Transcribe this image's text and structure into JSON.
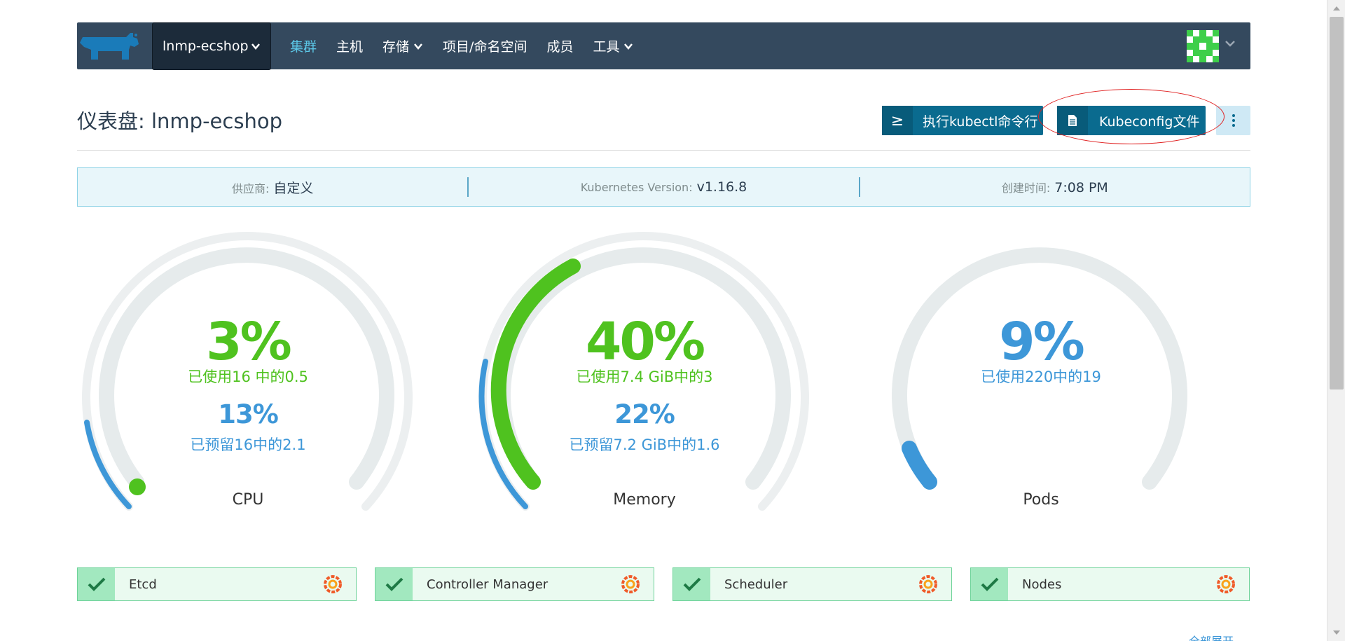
{
  "nav": {
    "cluster": "lnmp-ecshop",
    "items": [
      {
        "label": "集群",
        "active": true,
        "dropdown": false
      },
      {
        "label": "主机",
        "active": false,
        "dropdown": false
      },
      {
        "label": "存储",
        "active": false,
        "dropdown": true
      },
      {
        "label": "项目/命名空间",
        "active": false,
        "dropdown": false
      },
      {
        "label": "成员",
        "active": false,
        "dropdown": false
      },
      {
        "label": "工具",
        "active": false,
        "dropdown": true
      }
    ]
  },
  "header": {
    "title": "仪表盘: lnmp-ecshop",
    "kubectl_icon": "≥",
    "kubectl_label": "执行kubectl命令行",
    "kubeconfig_label": "Kubeconfig文件"
  },
  "info": {
    "provider_key": "供应商:",
    "provider_val": "自定义",
    "version_key": "Kubernetes Version:",
    "version_val": "v1.16.8",
    "created_key": "创建时间:",
    "created_val": "7:08 PM"
  },
  "gauges": {
    "cpu": {
      "used_pct": "3%",
      "used_text": "已使用16 中的0.5",
      "reserved_pct": "13%",
      "reserved_text": "已预留16中的2.1",
      "label": "CPU"
    },
    "memory": {
      "used_pct": "40%",
      "used_text": "已使用7.4 GiB中的3",
      "reserved_pct": "22%",
      "reserved_text": "已预留7.2 GiB中的1.6",
      "label": "Memory"
    },
    "pods": {
      "used_pct": "9%",
      "used_text": "已使用220中的19",
      "label": "Pods"
    }
  },
  "components": [
    {
      "name": "Etcd"
    },
    {
      "name": "Controller Manager"
    },
    {
      "name": "Scheduler"
    },
    {
      "name": "Nodes"
    }
  ],
  "expand_label": "全部展开",
  "colors": {
    "nav": "#34495e",
    "green": "#4fc21f",
    "blue": "#3d97d8",
    "button": "#0a6b8f"
  },
  "icons": {
    "logo": "rancher-cow-icon",
    "check": "check-icon",
    "grafana": "grafana-icon",
    "terminal": "terminal-icon",
    "file": "file-icon",
    "more": "kebab-icon"
  }
}
